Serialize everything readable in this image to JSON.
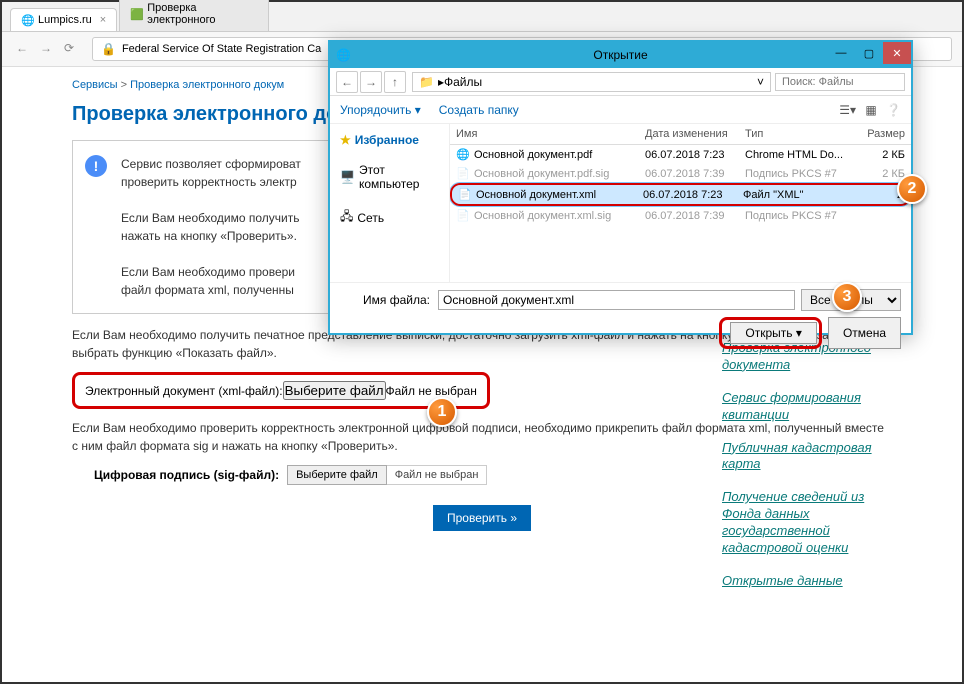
{
  "tabs": [
    {
      "label": "Lumpics.ru"
    },
    {
      "label": "Проверка электронного"
    }
  ],
  "address": {
    "text": "Federal Service Of State Registration Ca"
  },
  "breadcrumb": {
    "services": "Сервисы",
    "sep": ">",
    "current": "Проверка электронного докум"
  },
  "page_title": "Проверка электронного докум",
  "info_box": "Сервис позволяет сформироват\nпроверить корректность электр\n\nЕсли Вам необходимо получить\nнажать на кнопку «Проверить».\n\nЕсли Вам необходимо провери\nфайл формата xml, полученны",
  "desc1": "Если Вам необходимо получить печатное представление выписки, достаточно загрузить xml-файл и нажать на кнопку «Проверить», затем выбрать функцию «Показать файл».",
  "field1": {
    "label": "Электронный документ (xml-файл):",
    "btn": "Выберите файл",
    "status": "Файл не выбран"
  },
  "desc2": "Если Вам необходимо проверить корректность электронной цифровой подписи, необходимо прикрепить файл формата xml, полученный вместе с ним файл формата sig и нажать на кнопку «Проверить».",
  "field2": {
    "label": "Цифровая подпись (sig-файл):",
    "btn": "Выберите файл",
    "status": "Файл не выбран"
  },
  "verify_btn": "Проверить »",
  "sidebar_links": [
    "Проверка электронного документа",
    "Сервис формирования квитанции",
    "Публичная кадастровая карта",
    "Получение сведений из Фонда данных государственной кадастровой оценки",
    "Открытые данные"
  ],
  "dialog": {
    "title": "Открытие",
    "path": "Файлы",
    "search_placeholder": "Поиск: Файлы",
    "toolbar": {
      "organize": "Упорядочить ▾",
      "newfolder": "Создать папку"
    },
    "sidebar": {
      "fav": "Избранное",
      "pc": "Этот компьютер",
      "net": "Сеть"
    },
    "headers": {
      "name": "Имя",
      "date": "Дата изменения",
      "type": "Тип",
      "size": "Размер"
    },
    "files": [
      {
        "name": "Основной документ.pdf",
        "date": "06.07.2018 7:23",
        "type": "Chrome HTML Do...",
        "size": "2 КБ"
      },
      {
        "name": "Основной документ.pdf.sig",
        "date": "06.07.2018 7:39",
        "type": "Подпись PKCS #7",
        "size": "2 КБ"
      },
      {
        "name": "Основной документ.xml",
        "date": "06.07.2018 7:23",
        "type": "Файл \"XML\"",
        "size": "2"
      },
      {
        "name": "Основной документ.xml.sig",
        "date": "06.07.2018 7:39",
        "type": "Подпись PKCS #7",
        "size": ""
      }
    ],
    "fn_label": "Имя файла:",
    "fn_value": "Основной документ.xml",
    "filter": "Все файлы",
    "open_btn": "Открыть",
    "cancel_btn": "Отмена"
  },
  "badges": {
    "b1": "1",
    "b2": "2",
    "b3": "3"
  }
}
